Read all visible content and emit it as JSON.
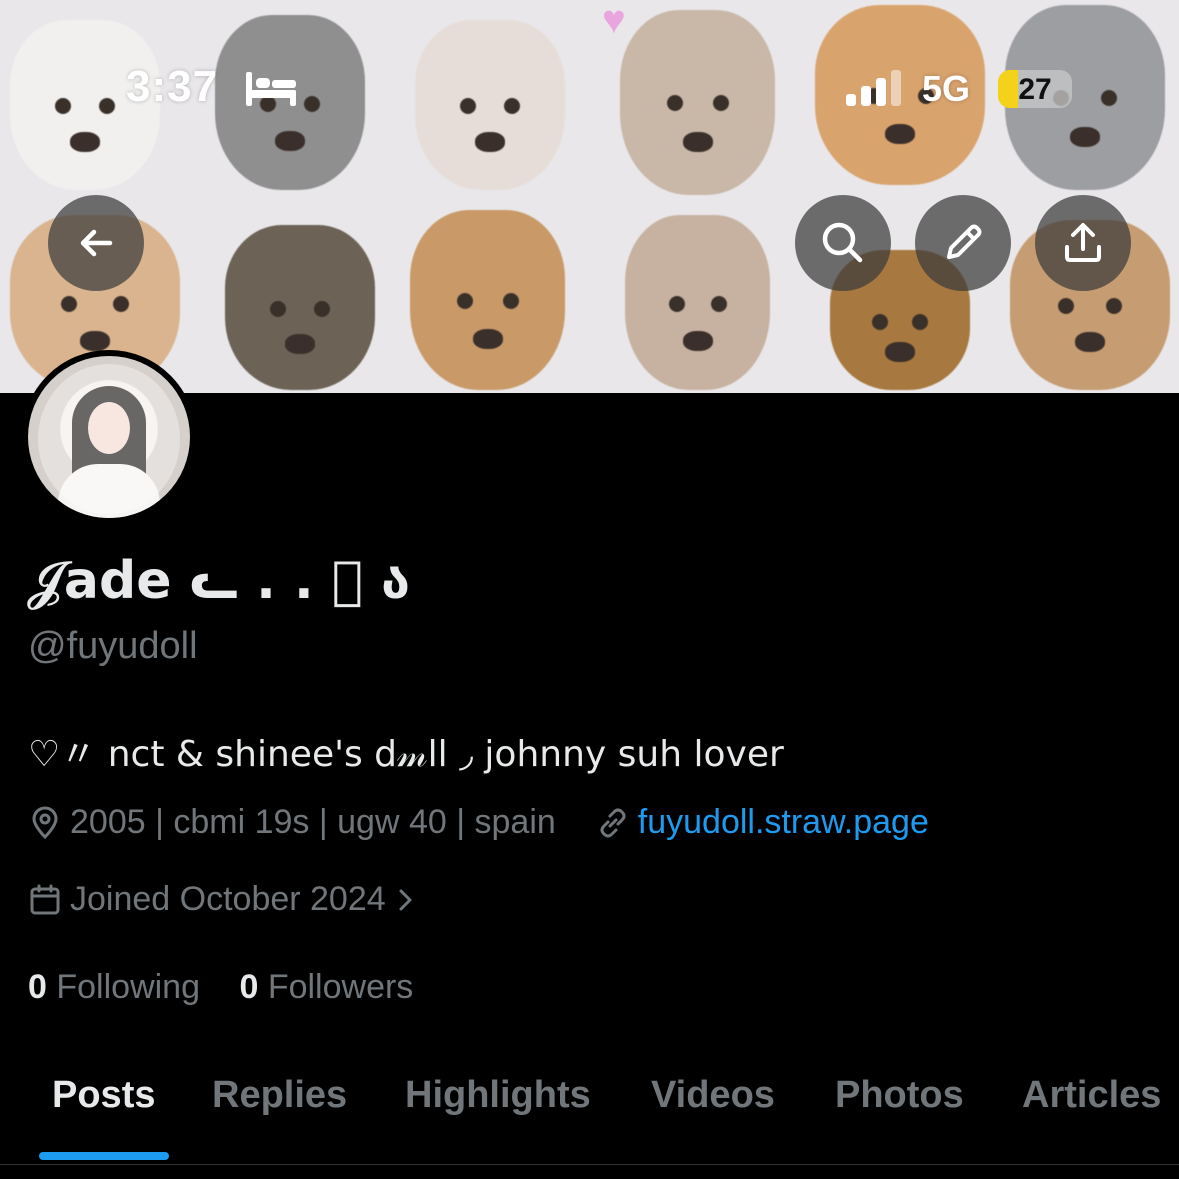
{
  "status_bar": {
    "time": "3:37",
    "network": "5G",
    "battery": "27",
    "icons": [
      "sleep-icon",
      "signal-icon"
    ]
  },
  "header": {
    "icons": [
      "back-arrow-icon",
      "search-icon",
      "edit-icon",
      "share-icon"
    ]
  },
  "profile": {
    "display_name": "𝒥ade ᓚ . . ᷟ ა",
    "handle": "@fuyudoll",
    "bio": "♡〃 nct & shinee's d𝓂ll ◞ johnny suh lover",
    "location": "2005 | cbmi 19s | ugw 40 | spain",
    "link": "fuyudoll.straw.page",
    "joined": "Joined October 2024",
    "following_count": "0",
    "following_label": "Following",
    "followers_count": "0",
    "followers_label": "Followers"
  },
  "tabs": [
    {
      "label": "Posts",
      "active": true
    },
    {
      "label": "Replies",
      "active": false
    },
    {
      "label": "Highlights",
      "active": false
    },
    {
      "label": "Videos",
      "active": false
    },
    {
      "label": "Photos",
      "active": false
    },
    {
      "label": "Articles",
      "active": false
    }
  ],
  "colors": {
    "background": "#000000",
    "accent": "#1d9bf0",
    "secondary_text": "#71767b",
    "primary_text": "#e7e9ea"
  }
}
